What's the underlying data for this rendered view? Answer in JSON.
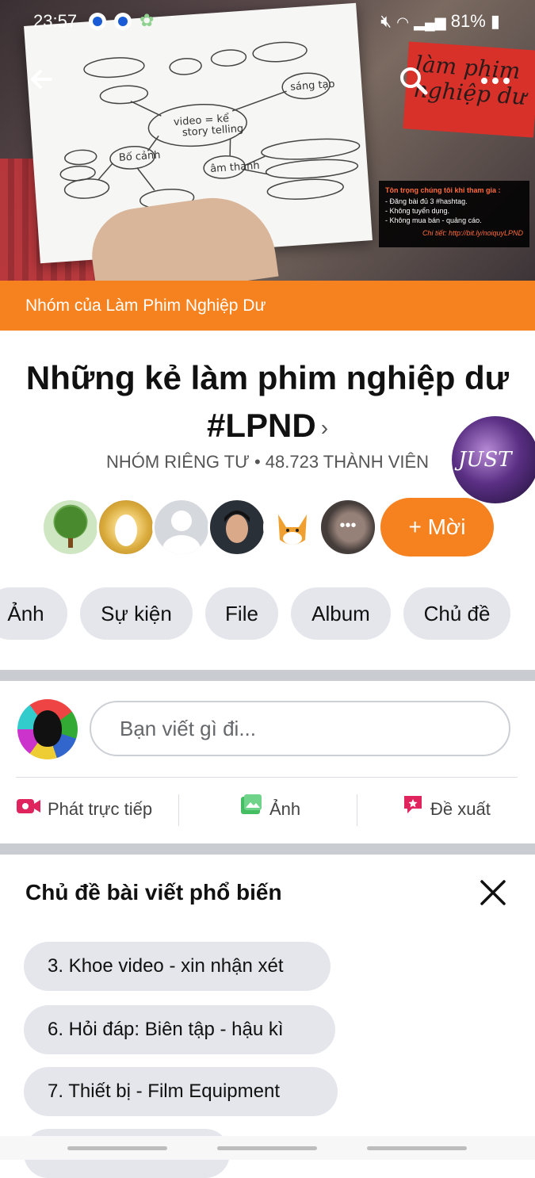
{
  "status_bar": {
    "time": "23:57",
    "battery": "81%"
  },
  "cover": {
    "sign_text": "làm phim nghiệp dư",
    "notice": {
      "title": "Tôn trọng chúng tôi khi tham gia :",
      "line1": "- Đăng bài đủ 3 #hashtag.",
      "line2": "- Không tuyển dụng.",
      "line3": "- Không mua bán - quảng cáo.",
      "link": "Chi tiết: http://bit.ly/noiquyLPND"
    }
  },
  "banner": {
    "text": "Nhóm của Làm Phim Nghiệp Dư",
    "color": "#f5821f"
  },
  "group": {
    "title_line1": "Những kẻ làm phim nghiệp dư",
    "title_line2": "#LPND",
    "chevron": "›",
    "meta": "NHÓM RIÊNG TƯ • 48.723 THÀNH VIÊN",
    "avatar_text": "JUST"
  },
  "members": {
    "more_icon": "•••",
    "invite_label": "+ Mời",
    "avatars": [
      "tree-avatar",
      "gold-avatar",
      "placeholder-avatar",
      "man-avatar",
      "fox-avatar",
      "baby-avatar"
    ]
  },
  "chips": [
    "Ảnh",
    "Sự kiện",
    "File",
    "Album",
    "Chủ đề"
  ],
  "composer": {
    "placeholder": "Bạn viết gì đi..."
  },
  "actions": {
    "live": "Phát trực tiếp",
    "photo": "Ảnh",
    "suggest": "Đề xuất"
  },
  "topics": {
    "title": "Chủ đề bài viết phổ biến",
    "close_icon": "×",
    "items": [
      "3. Khoe video - xin nhận xét",
      "6. Hỏi đáp: Biên tập - hậu kì",
      "7. Thiết bị - Film Equipment"
    ]
  }
}
